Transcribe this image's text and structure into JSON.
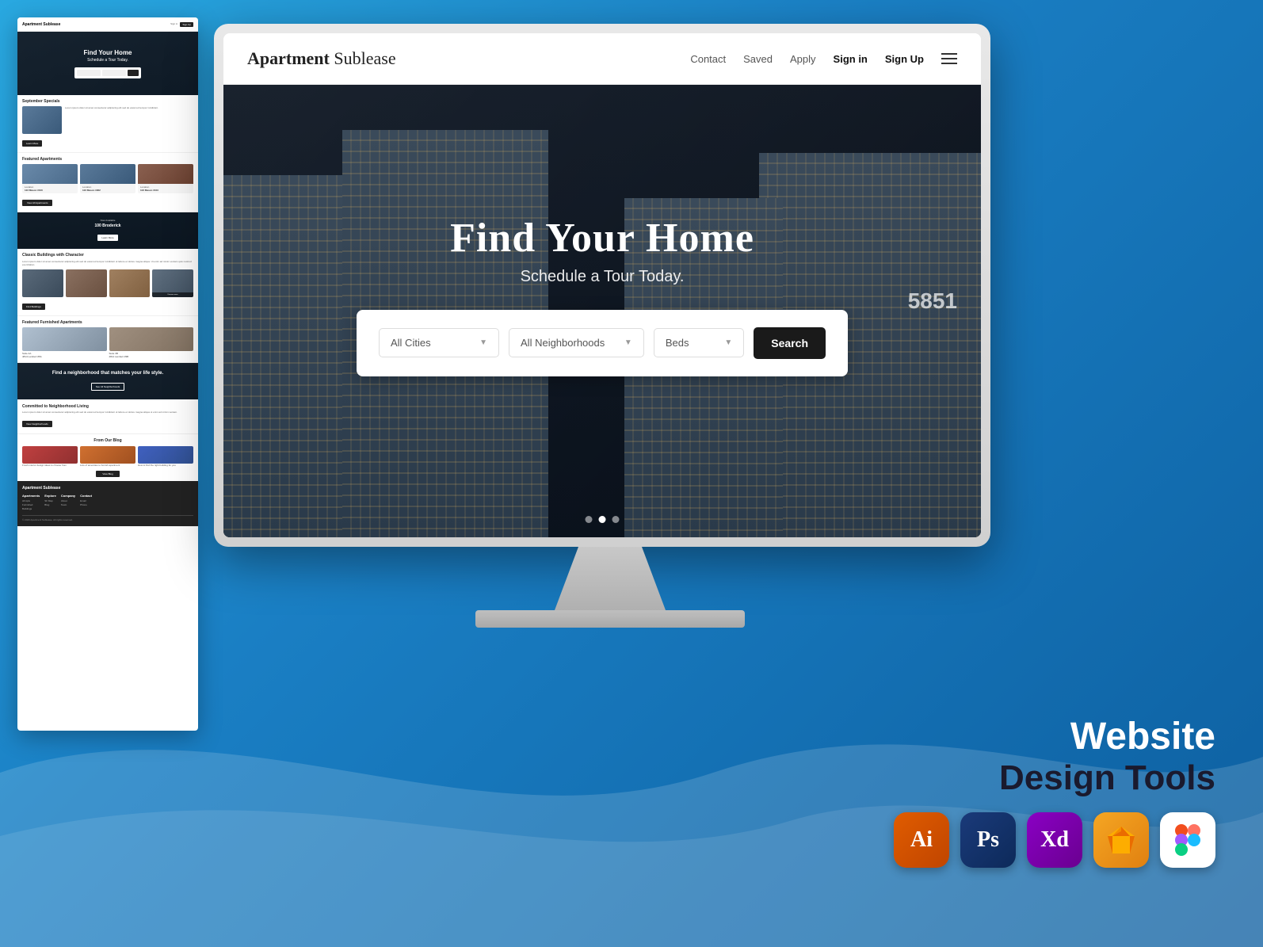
{
  "background": {
    "gradient_start": "#29a8e0",
    "gradient_end": "#0d5fa0"
  },
  "small_mockup": {
    "brand": "Apartment Sublease",
    "hero_title": "Find Your Home",
    "hero_subtitle": "Schedule a Tour Today.",
    "sept_special": "September Specials",
    "featured_title": "Featured Apartments",
    "building_100": "100 Broderick",
    "classic_title": "Classic Buildings with Character",
    "furnished_title": "Featured Furnished Apartments",
    "neighborhood_text": "Find a neighborhood that matches your life style.",
    "see_all_neighborhoods": "See All Neighborhoods",
    "committed_title": "Committed to Neighborhood Living",
    "blog_title": "From Our Blog",
    "view_blog": "View Blog",
    "footer_brand": "Apartment Sublease",
    "footer_cols": [
      "Apartments",
      "Explore",
      "Company",
      "Contact"
    ]
  },
  "monitor": {
    "navbar": {
      "brand_bold": "Apartment",
      "brand_light": " Sublease",
      "links": [
        "Contact",
        "Saved",
        "Apply"
      ],
      "sign_in": "Sign in",
      "sign_up": "Sign Up"
    },
    "hero": {
      "title": "Find Your Home",
      "subtitle": "Schedule a Tour Today.",
      "building_number": "5851"
    },
    "search": {
      "cities_label": "All Cities",
      "neighborhoods_label": "All Neighborhoods",
      "beds_label": "Beds",
      "search_btn": "Search"
    },
    "carousel_dots": [
      {
        "active": false
      },
      {
        "active": true
      },
      {
        "active": false
      }
    ]
  },
  "tools": {
    "title_website": "Website",
    "title_design_tools": "Design Tools",
    "icons": [
      {
        "name": "adobe-illustrator",
        "label": "Ai",
        "class": "tool-ai"
      },
      {
        "name": "adobe-photoshop",
        "label": "Ps",
        "class": "tool-ps"
      },
      {
        "name": "adobe-xd",
        "label": "Xd",
        "class": "tool-xd"
      },
      {
        "name": "sketch",
        "label": "S",
        "class": "tool-sk"
      },
      {
        "name": "figma",
        "label": "fig",
        "class": "tool-fi"
      }
    ]
  }
}
